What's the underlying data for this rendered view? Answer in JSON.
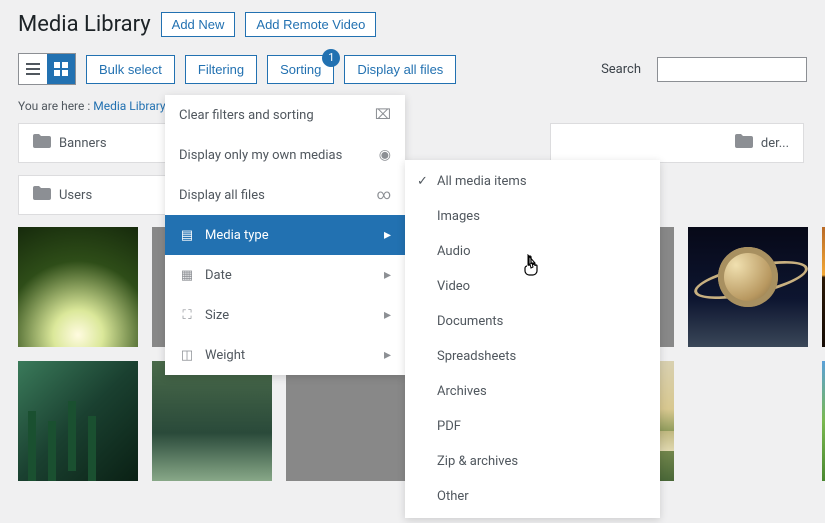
{
  "header": {
    "title": "Media Library",
    "add_new": "Add New",
    "add_remote": "Add Remote Video"
  },
  "toolbar": {
    "bulk_select": "Bulk select",
    "filtering": "Filtering",
    "sorting": "Sorting",
    "sorting_badge": "1",
    "display_all": "Display all files",
    "search_label": "Search"
  },
  "breadcrumb": {
    "prefix": "You are here",
    "sep": " : ",
    "current": "Media Library"
  },
  "folders": {
    "banners": "Banners",
    "users": "Users",
    "new": "der..."
  },
  "dropdown": {
    "clear": "Clear filters and sorting",
    "only_own": "Display only my own medias",
    "display_all": "Display all files",
    "media_type": "Media type",
    "date": "Date",
    "size": "Size",
    "weight": "Weight"
  },
  "submenu": {
    "all": "All media items",
    "images": "Images",
    "audio": "Audio",
    "video": "Video",
    "documents": "Documents",
    "spreadsheets": "Spreadsheets",
    "archives": "Archives",
    "pdf": "PDF",
    "zip": "Zip & archives",
    "other": "Other"
  }
}
